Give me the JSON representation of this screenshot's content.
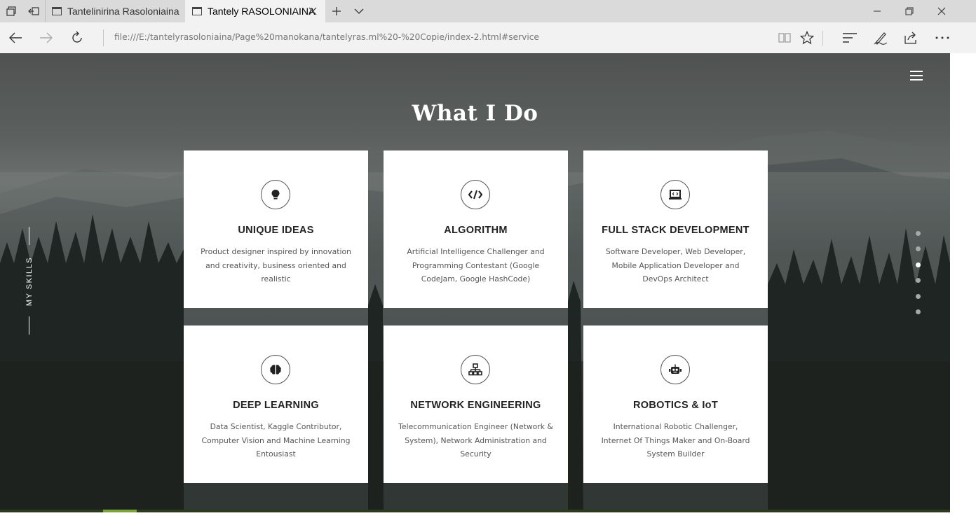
{
  "browser": {
    "tabs": [
      {
        "title": "Tantelinirina Rasoloniaina"
      },
      {
        "title": "Tantely RASOLONIAINA"
      }
    ],
    "url": "file:///E:/tantelyrasoloniaina/Page%20manokana/tantelyras.ml%20-%20Copie/index-2.html#service"
  },
  "page": {
    "section_title": "What I Do",
    "side_label": "MY SKILLS",
    "active_dot_index": 2,
    "dot_count": 6,
    "scroll_progress_label": "",
    "cards": [
      {
        "icon": "lightbulb-icon",
        "title": "UNIQUE IDEAS",
        "desc": "Product designer inspired by innovation and creativity, business oriented and realistic"
      },
      {
        "icon": "code-icon",
        "title": "ALGORITHM",
        "desc": "Artificial Intelligence Challenger and Programming Contestant (Google CodeJam, Google HashCode)"
      },
      {
        "icon": "laptop-code-icon",
        "title": "FULL STACK DEVELOPMENT",
        "desc": "Software Developer, Web Developer, Mobile Application Developer and DevOps Architect"
      },
      {
        "icon": "brain-icon",
        "title": "DEEP LEARNING",
        "desc": "Data Scientist, Kaggle Contributor, Computer Vision and Machine Learning Entousiast"
      },
      {
        "icon": "network-icon",
        "title": "NETWORK ENGINEERING",
        "desc": "Telecommunication Engineer (Network & System), Network Administration and Security"
      },
      {
        "icon": "robot-icon",
        "title": "ROBOTICS & IoT",
        "desc": "International Robotic Challenger, Internet Of Things Maker and On-Board System Builder"
      }
    ]
  },
  "colors": {
    "accent_progress": "#7da33b",
    "card_bg": "#ffffff",
    "title_color": "#ffffff"
  }
}
